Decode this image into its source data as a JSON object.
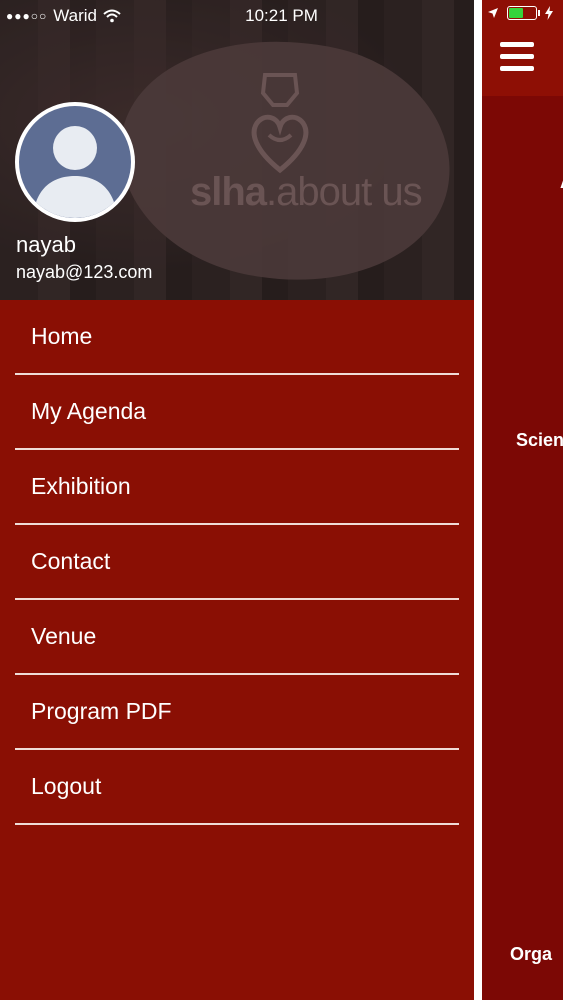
{
  "status_bar": {
    "carrier": "Warid",
    "time": "10:21 PM"
  },
  "drawer": {
    "header": {
      "logo_text_bold": "slha",
      "logo_text_light": ".about us"
    },
    "user": {
      "name": "nayab",
      "email": "nayab@123.com"
    },
    "menu": [
      {
        "label": "Home"
      },
      {
        "label": "My Agenda"
      },
      {
        "label": "Exhibition"
      },
      {
        "label": "Contact"
      },
      {
        "label": "Venue"
      },
      {
        "label": "Program PDF"
      },
      {
        "label": "Logout"
      }
    ]
  },
  "main": {
    "peek_text_1": "A",
    "peek_text_2": "Scien",
    "peek_text_3": "Orga"
  },
  "colors": {
    "drawer_bg": "#8a0f04",
    "main_bg": "#7c0805",
    "topbar_bg": "#8e0f05",
    "avatar_bg": "#5d6d93",
    "battery_green": "#35d43b"
  },
  "icons": [
    "hamburger-menu-icon",
    "location-arrow-icon",
    "battery-icon",
    "wifi-icon",
    "charging-icon",
    "avatar-silhouette-icon"
  ]
}
